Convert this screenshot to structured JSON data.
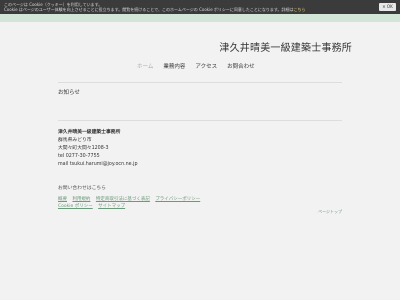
{
  "cookie_bar": {
    "line1": "このページは Cookie（クッキー）を利用しています。",
    "line2": "Cookie はページのユーザー体験を向上させることに役立ちます。閲覧を続けることで、このホームページの Cookie ポリシーに同意したことになります。詳細は",
    "link": "こちら",
    "ok_label": "OK"
  },
  "header": {
    "site_title": "津久井晴美一級建築士事務所"
  },
  "nav": {
    "items": [
      "ホーム",
      "業務内容",
      "アクセス",
      "お問合わせ"
    ]
  },
  "main": {
    "heading": "お知らせ",
    "office_name": "津久井晴美一級建築士事務所",
    "address1": "群馬県みどり市",
    "address2": "大間々町大間々1208-3",
    "tel": "tel 0277-30-7755",
    "mail": "mail tsukui.harumi@joy.ocn.ne.jp",
    "contact_link": "お問い合わせはこちら"
  },
  "footer": {
    "links_row1": [
      "概要",
      "利用規約",
      "特定商取引法に基づく表記",
      "プライバシーポリシー"
    ],
    "links_row2": [
      "Cookie ポリシー",
      "サイトマップ"
    ],
    "page_top": "ページトップ"
  }
}
